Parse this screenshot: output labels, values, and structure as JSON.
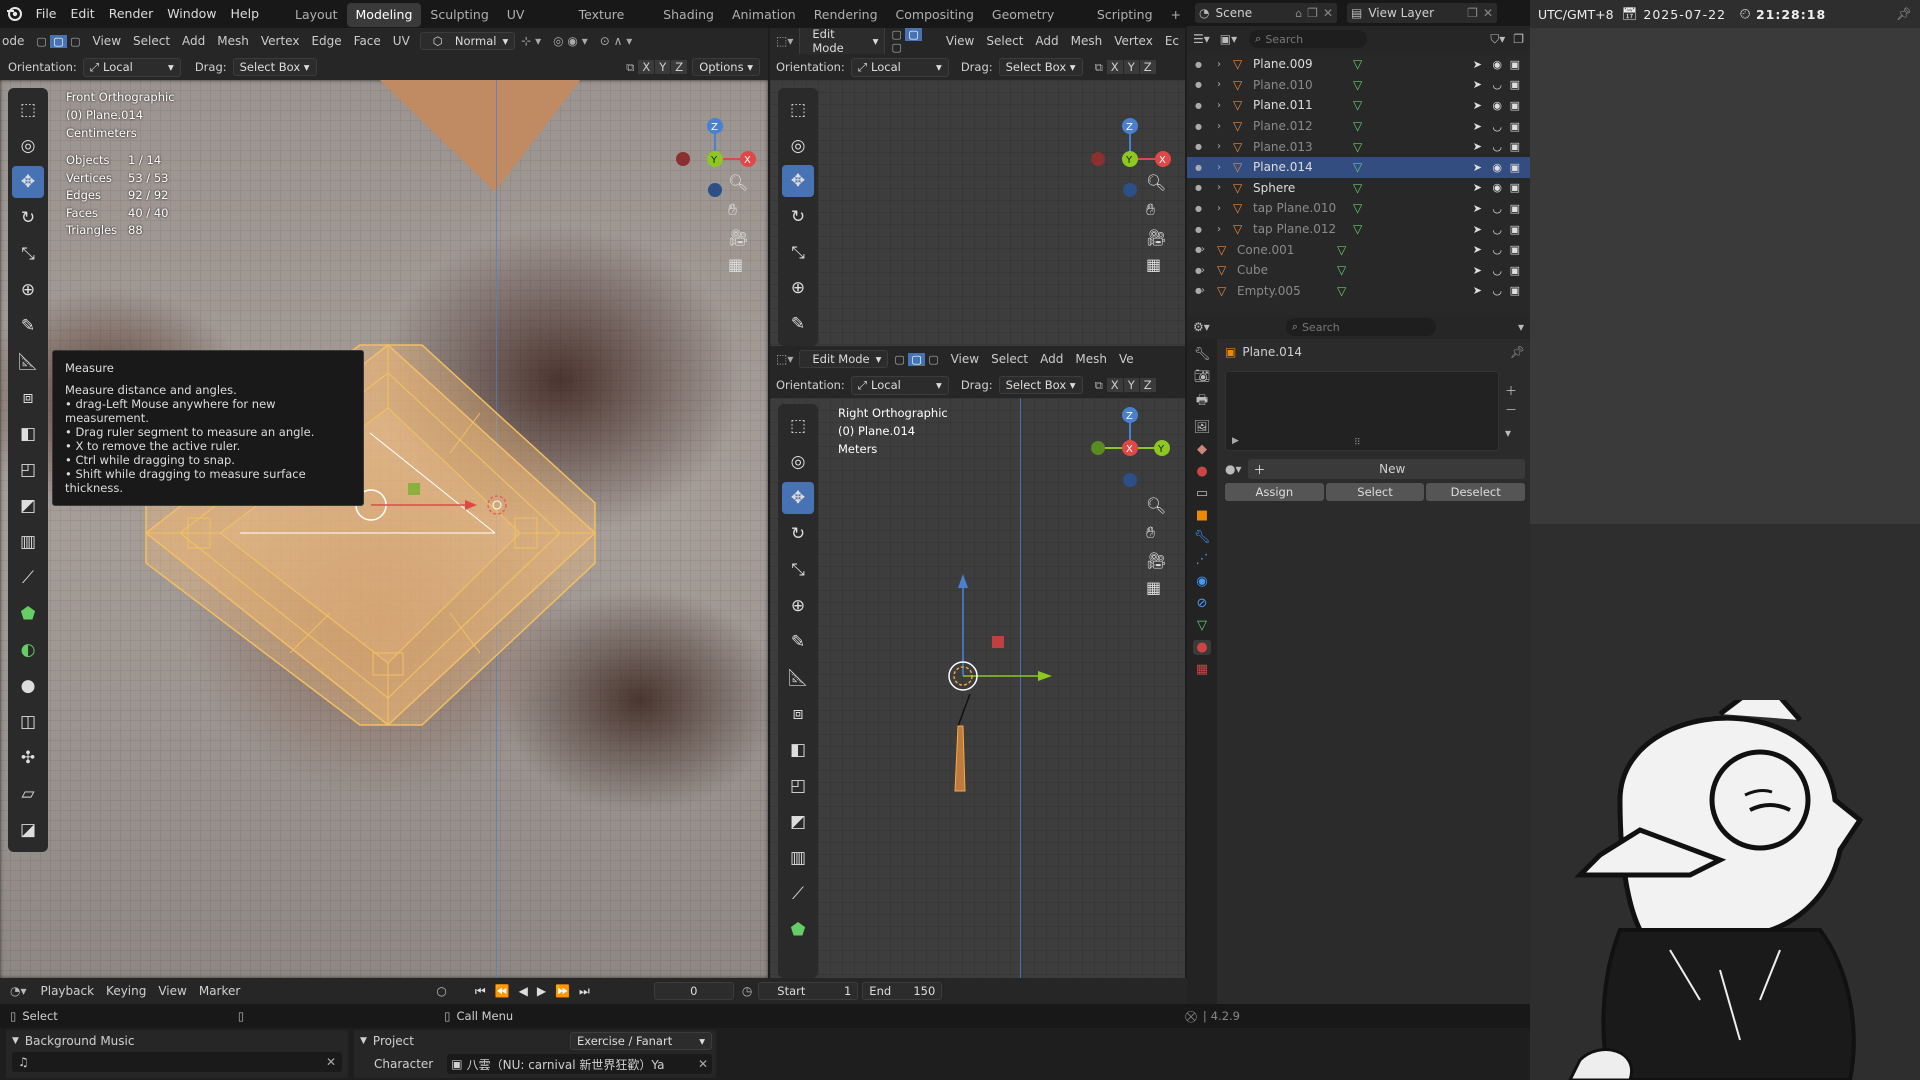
{
  "topbar": {
    "menus": [
      "File",
      "Edit",
      "Render",
      "Window",
      "Help"
    ],
    "workspaces": [
      "Layout",
      "Modeling",
      "Sculpting",
      "UV Editing",
      "Texture Paint",
      "Shading",
      "Animation",
      "Rendering",
      "Compositing",
      "Geometry Nodes",
      "Scripting"
    ],
    "active_workspace": "Modeling",
    "scene_label": "Scene",
    "view_layer_label": "View Layer"
  },
  "clock": {
    "timezone": "UTC/GMT+8",
    "date": "2025-07-22",
    "time": "21:28:18"
  },
  "left_view": {
    "header": {
      "mode": "ode",
      "menus": [
        "View",
        "Select",
        "Add",
        "Mesh",
        "Vertex",
        "Edge",
        "Face",
        "UV"
      ],
      "shading": "Normal"
    },
    "header2": {
      "orientation_label": "Orientation:",
      "orientation": "Local",
      "drag_label": "Drag:",
      "drag": "Select Box",
      "axes": [
        "X",
        "Y",
        "Z"
      ],
      "options": "Options"
    },
    "info": {
      "view_name": "Front Orthographic",
      "object": "(0) Plane.014",
      "units": "Centimeters"
    },
    "stats": [
      {
        "label": "Objects",
        "value": "1 / 14"
      },
      {
        "label": "Vertices",
        "value": "53 / 53"
      },
      {
        "label": "Edges",
        "value": "92 / 92"
      },
      {
        "label": "Faces",
        "value": "40 / 40"
      },
      {
        "label": "Triangles",
        "value": "88"
      }
    ],
    "tooltip": {
      "title": "Measure",
      "lines": [
        "Measure distance and angles.",
        "• drag-Left Mouse anywhere for new measurement.",
        "• Drag ruler segment to measure an angle.",
        "• X to remove the active ruler.",
        "• Ctrl while dragging to snap.",
        "• Shift while dragging to measure surface thickness."
      ]
    }
  },
  "mid_top_view": {
    "header": {
      "mode": "Edit Mode",
      "menus": [
        "View",
        "Select",
        "Add",
        "Mesh",
        "Vertex",
        "Ec"
      ]
    },
    "header2": {
      "orientation_label": "Orientation:",
      "orientation": "Local",
      "drag_label": "Drag:",
      "drag": "Select Box",
      "axes": [
        "X",
        "Y",
        "Z"
      ]
    }
  },
  "mid_bottom_view": {
    "header": {
      "mode": "Edit Mode",
      "menus": [
        "View",
        "Select",
        "Add",
        "Mesh",
        "Ve"
      ]
    },
    "header2": {
      "orientation_label": "Orientation:",
      "orientation": "Local",
      "drag_label": "Drag:",
      "drag": "Select Box",
      "axes": [
        "X",
        "Y",
        "Z"
      ]
    },
    "info": {
      "view_name": "Right Orthographic",
      "object": "(0) Plane.014",
      "units": "Meters"
    }
  },
  "outliner": {
    "search_placeholder": "Search",
    "items": [
      {
        "name": "Plane.009",
        "dim": false,
        "selected": false,
        "indent": 1
      },
      {
        "name": "Plane.010",
        "dim": true,
        "selected": false,
        "indent": 1
      },
      {
        "name": "Plane.011",
        "dim": false,
        "selected": false,
        "indent": 1
      },
      {
        "name": "Plane.012",
        "dim": true,
        "selected": false,
        "indent": 1
      },
      {
        "name": "Plane.013",
        "dim": true,
        "selected": false,
        "indent": 1
      },
      {
        "name": "Plane.014",
        "dim": false,
        "selected": true,
        "indent": 1
      },
      {
        "name": "Sphere",
        "dim": false,
        "selected": false,
        "indent": 1
      },
      {
        "name": "tap Plane.010",
        "dim": true,
        "selected": false,
        "indent": 1
      },
      {
        "name": "tap Plane.012",
        "dim": true,
        "selected": false,
        "indent": 1
      },
      {
        "name": "Cone.001",
        "dim": true,
        "selected": false,
        "indent": 0
      },
      {
        "name": "Cube",
        "dim": true,
        "selected": false,
        "indent": 0
      },
      {
        "name": "Empty.005",
        "dim": true,
        "selected": false,
        "indent": 0
      }
    ]
  },
  "properties": {
    "search_placeholder": "Search",
    "object_name": "Plane.014",
    "new_label": "New",
    "assign_label": "Assign",
    "select_label": "Select",
    "deselect_label": "Deselect"
  },
  "timeline": {
    "menus": [
      "Playback",
      "Keying",
      "View",
      "Marker"
    ],
    "current_frame": "0",
    "start_label": "Start",
    "start": "1",
    "end_label": "End",
    "end": "150"
  },
  "statusbar": {
    "select": "Select",
    "call_menu": "Call Menu",
    "version": "4.2.9"
  },
  "bottom": {
    "music_label": "Background Music",
    "project_label": "Project",
    "project_value": "Exercise / Fanart",
    "character_label": "Character",
    "character_value": "八雲（NU: carnival 新世界狂歡）Ya"
  },
  "colors": {
    "accent": "#4772b3",
    "mesh_edge": "#f0b040",
    "x_axis": "#e04848",
    "y_axis": "#8cc820",
    "z_axis": "#4a80d0"
  }
}
